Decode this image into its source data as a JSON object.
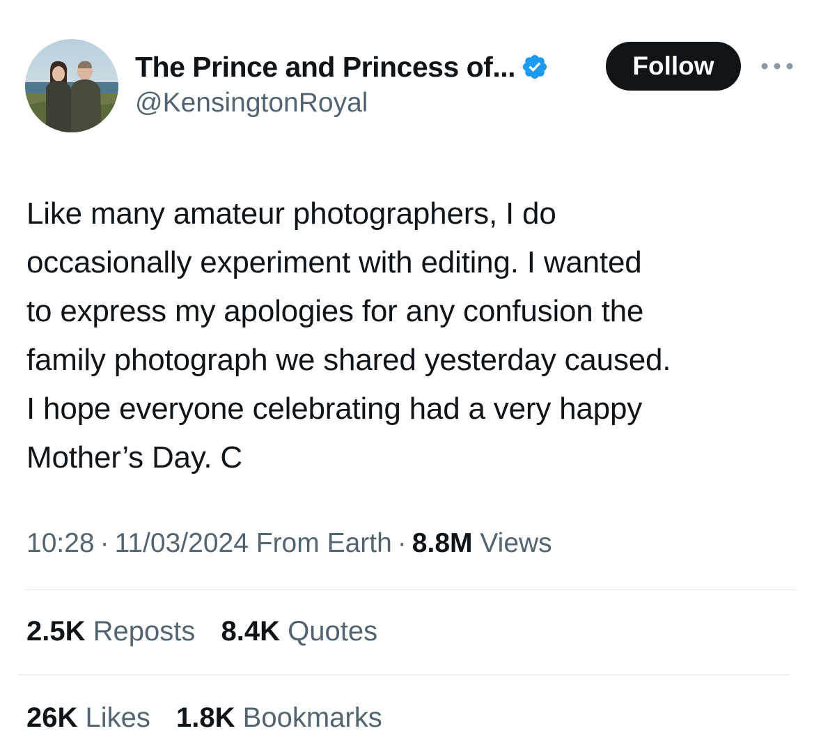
{
  "author": {
    "display_name": "The Prince and Princess of...",
    "handle": "@KensingtonRoyal",
    "verified": true,
    "verified_color": "#1d9bf0"
  },
  "follow_button": {
    "label": "Follow"
  },
  "more_button": {
    "icon": "more-horizontal-icon"
  },
  "tweet": {
    "lines": [
      "Like many amateur photographers, I do",
      "occasionally experiment with editing. I wanted",
      "to express my apologies for any confusion the",
      "family photograph we shared yesterday caused.",
      "I hope everyone celebrating had a very happy",
      "Mother’s Day. C"
    ]
  },
  "meta": {
    "time": "10:28",
    "date": "11/03/2024",
    "source": "From Earth",
    "separator": "·",
    "views_count": "8.8M",
    "views_label": "Views"
  },
  "stats": {
    "reposts": {
      "count": "2.5K",
      "label": "Reposts"
    },
    "quotes": {
      "count": "8.4K",
      "label": "Quotes"
    },
    "likes": {
      "count": "26K",
      "label": "Likes"
    },
    "bookmarks": {
      "count": "1.8K",
      "label": "Bookmarks"
    }
  }
}
